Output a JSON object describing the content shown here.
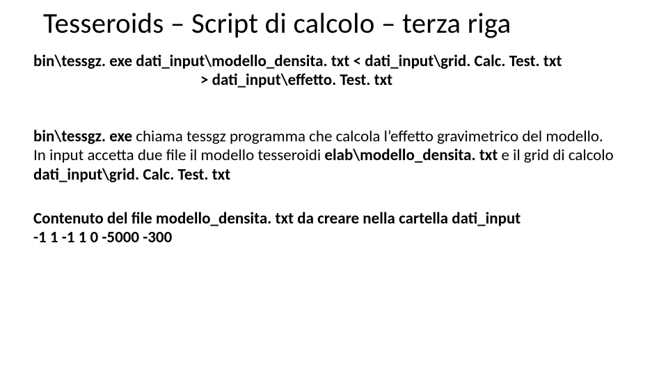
{
  "title": "Tesseroids – Script di calcolo – terza riga",
  "cmd": {
    "line1": "bin\\tessgz. exe dati_input\\modello_densita. txt < dati_input\\grid. Calc. Test. txt",
    "line2": "> dati_input\\effetto. Test. txt"
  },
  "desc": {
    "b1": "bin\\tessgz. exe",
    "t1": " chiama tessgz programma che calcola l’effetto gravimetrico del modello.",
    "t2": "In input accetta due file il modello tesseroidi ",
    "b2": "elab\\modello_densita. txt",
    "t3": " e il grid di calcolo ",
    "b3": "dati_input\\grid. Calc. Test. txt"
  },
  "footer": {
    "l1": "Contenuto del file modello_densita. txt da creare nella cartella dati_input",
    "l2": "-1 1 -1 1 0 -5000 -300"
  }
}
